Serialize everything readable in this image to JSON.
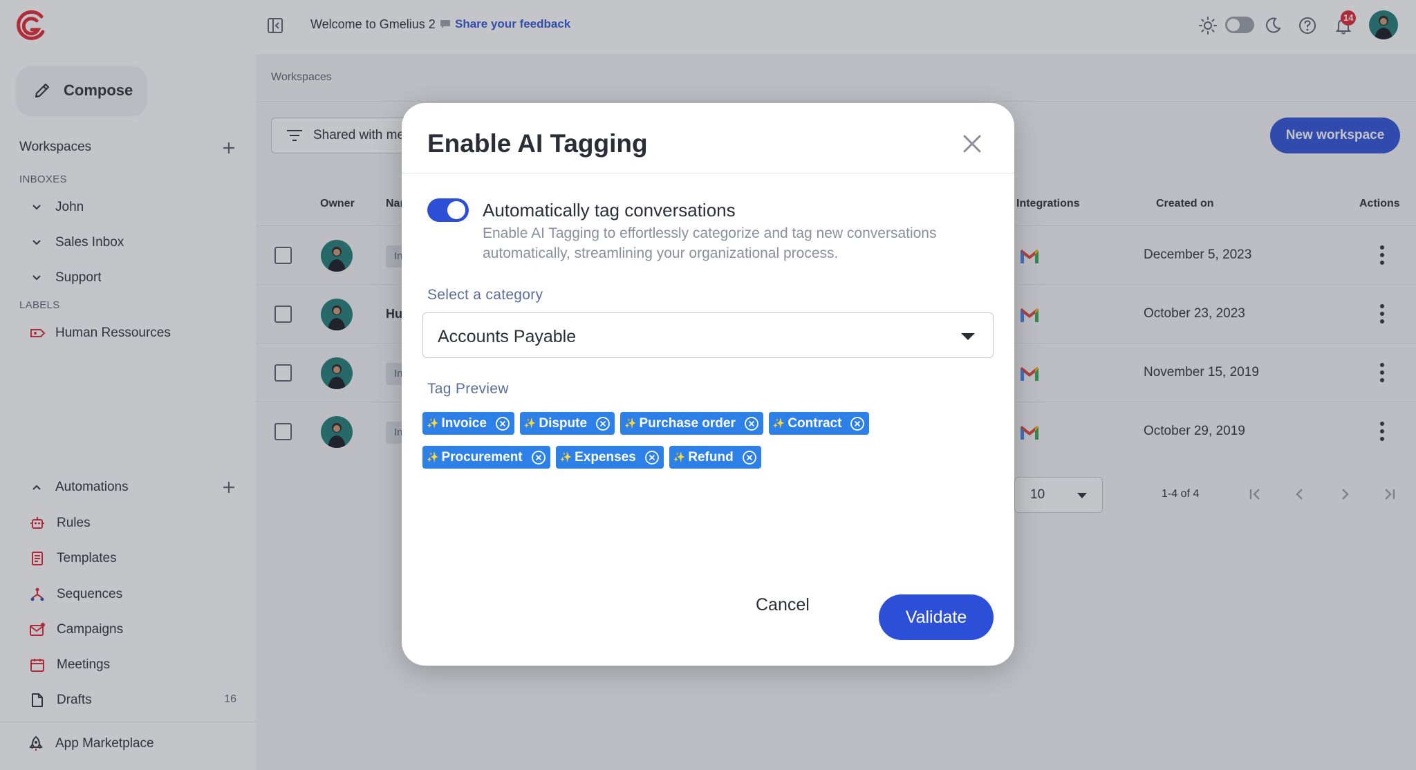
{
  "header": {
    "welcome": "Welcome to Gmelius 2",
    "feedback": "Share your feedback",
    "notifications_count": "14"
  },
  "sidebar": {
    "compose_label": "Compose",
    "workspaces_label": "Workspaces",
    "inboxes_section": "INBOXES",
    "inboxes": [
      "John",
      "Sales Inbox",
      "Support"
    ],
    "labels_section": "LABELS",
    "labels": [
      "Human Ressources"
    ],
    "automations_label": "Automations",
    "automation_items": [
      "Rules",
      "Templates",
      "Sequences",
      "Campaigns",
      "Meetings",
      "Drafts"
    ],
    "drafts_count": "16",
    "marketplace": "App Marketplace"
  },
  "main": {
    "breadcrumb": "Workspaces",
    "filter_label": "Shared with me",
    "new_workspace": "New workspace",
    "columns": {
      "owner": "Owner",
      "name": "Name",
      "integrations": "Integrations",
      "created_on": "Created on",
      "actions": "Actions"
    },
    "rows": [
      {
        "name_chip": "In",
        "created_on": "December 5, 2023"
      },
      {
        "name": "Hu",
        "created_on": "October 23, 2023"
      },
      {
        "name_chip": "In",
        "created_on": "November 15, 2019"
      },
      {
        "name_chip": "In",
        "created_on": "October 29, 2019"
      }
    ],
    "per_page": "10",
    "page_range": "1-4 of 4"
  },
  "modal": {
    "title": "Enable AI Tagging",
    "switch_label": "Automatically tag conversations",
    "switch_on": true,
    "switch_description": "Enable AI Tagging to effortlessly categorize and tag new conversations automatically, streamlining your organizational process.",
    "category_label": "Select a category",
    "category_value": "Accounts Payable",
    "preview_label": "Tag Preview",
    "tags": [
      "Invoice",
      "Dispute",
      "Purchase order",
      "Contract",
      "Procurement",
      "Expenses",
      "Refund"
    ],
    "cancel": "Cancel",
    "validate": "Validate"
  },
  "colors": {
    "accent": "#2c4fd8",
    "tag": "#2c80e8",
    "badge": "#e02235"
  }
}
